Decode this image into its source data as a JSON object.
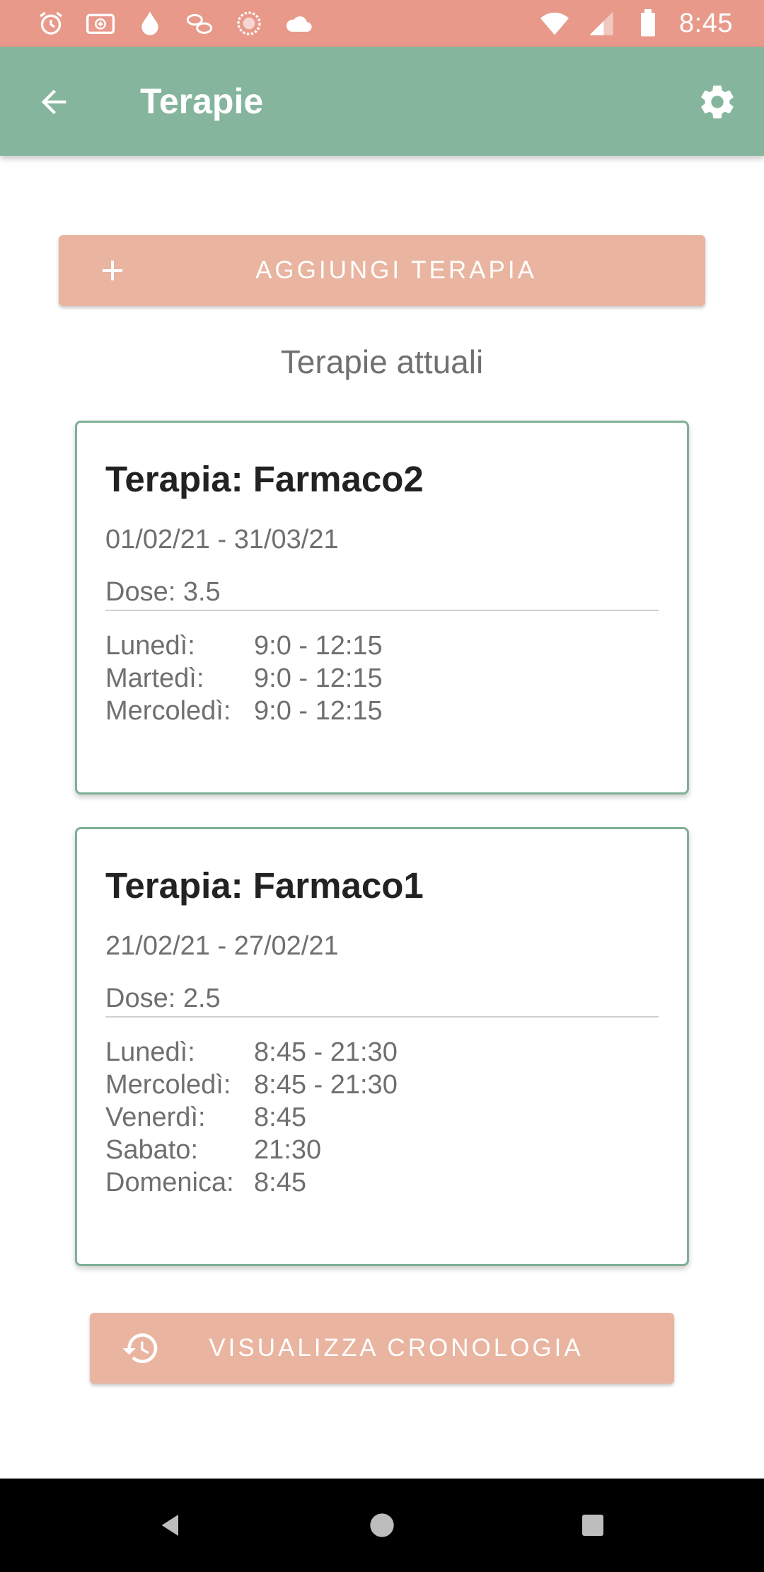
{
  "status_bar": {
    "time": "8:45",
    "left_icons": [
      "alarm-icon",
      "medical-box-icon",
      "water-drop-icon",
      "pills-icon",
      "sun-icon",
      "cloud-icon"
    ],
    "right_icons": [
      "wifi-icon",
      "signal-icon",
      "battery-icon"
    ]
  },
  "app_bar": {
    "title": "Terapie",
    "background": "#85B59D"
  },
  "add_button": {
    "label": "AGGIUNGI TERAPIA"
  },
  "section_title": "Terapie attuali",
  "therapies": [
    {
      "title": "Terapia: Farmaco2",
      "dates": "01/02/21 - 31/03/21",
      "dose": "Dose: 3.5",
      "schedule": [
        {
          "day": "Lunedì:",
          "time": "9:0 - 12:15"
        },
        {
          "day": "Martedì:",
          "time": "9:0 - 12:15"
        },
        {
          "day": "Mercoledì:",
          "time": "9:0 - 12:15"
        }
      ]
    },
    {
      "title": "Terapia: Farmaco1",
      "dates": "21/02/21 - 27/02/21",
      "dose": "Dose: 2.5",
      "schedule": [
        {
          "day": "Lunedì:",
          "time": "8:45 - 21:30"
        },
        {
          "day": "Mercoledì:",
          "time": "8:45 - 21:30"
        },
        {
          "day": "Venerdì:",
          "time": "8:45"
        },
        {
          "day": "Sabato:",
          "time": "21:30"
        },
        {
          "day": "Domenica:",
          "time": "8:45"
        }
      ]
    }
  ],
  "history_button": {
    "label": "VISUALIZZA CRONOLOGIA"
  },
  "colors": {
    "status_bar": "#E8998A",
    "button": "#E9B4A0",
    "card_border": "#7FAF98"
  }
}
